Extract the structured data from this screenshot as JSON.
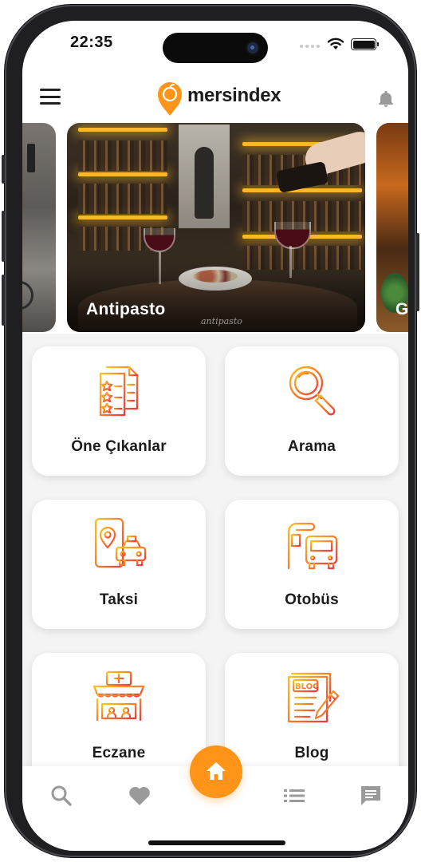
{
  "status_bar": {
    "time": "22:35",
    "battery_level": 1.0
  },
  "header": {
    "brand": "mersindex",
    "menu_icon": "hamburger-menu-icon",
    "notification_icon": "bell-icon",
    "accent_color": "#ff9418"
  },
  "carousel": {
    "slides": [
      {
        "title": ""
      },
      {
        "title": "Antipasto",
        "watermark": "antipasto"
      },
      {
        "title": "G"
      }
    ]
  },
  "categories": [
    {
      "label": "Öne Çıkanlar",
      "icon": "featured-list-icon"
    },
    {
      "label": "Arama",
      "icon": "magnifier-icon"
    },
    {
      "label": "Taksi",
      "icon": "taxi-icon"
    },
    {
      "label": "Otobüs",
      "icon": "bus-stop-icon"
    },
    {
      "label": "Eczane",
      "icon": "pharmacy-icon"
    },
    {
      "label": "Blog",
      "icon": "blog-icon"
    }
  ],
  "bottom_nav": {
    "items": [
      {
        "icon": "search-icon"
      },
      {
        "icon": "heart-icon"
      },
      {
        "icon": "home-icon"
      },
      {
        "icon": "list-icon"
      },
      {
        "icon": "chat-icon"
      }
    ],
    "inactive_color": "#9a9a9a",
    "active_color": "#ff9418"
  }
}
